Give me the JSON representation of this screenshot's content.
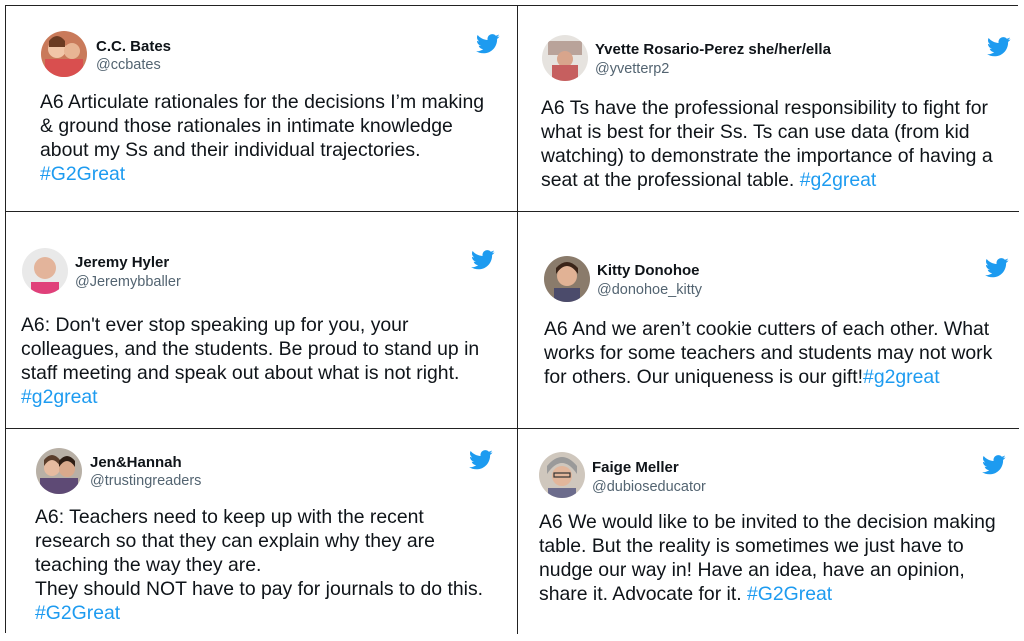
{
  "tweets": [
    {
      "name": "C.C. Bates",
      "handle": "@ccbates",
      "text": "A6 Articulate rationales for the decisions I’m making\n& ground those rationales in intimate knowledge\nabout my Ss and their individual trajectories.\n",
      "hashtag": "#G2Great"
    },
    {
      "name": "Yvette Rosario-Perez she/her/ella",
      "handle": "@yvetterp2",
      "text": "A6 Ts have the professional responsibility to fight for\nwhat is best for their Ss. Ts can use data (from kid\nwatching) to demonstrate the importance of having a\nseat at the professional table. ",
      "hashtag": "#g2great"
    },
    {
      "name": "Jeremy Hyler",
      "handle": "@Jeremybballer",
      "text": "A6: Don't ever stop speaking up for you, your\ncolleagues, and the students. Be proud to stand up in\nstaff meeting and speak out about what is not right.\n",
      "hashtag": "#g2great"
    },
    {
      "name": "Kitty Donohoe",
      "handle": "@donohoe_kitty",
      "text": "A6 And we aren’t cookie cutters of each other. What\nworks for some teachers and students may not work\nfor others. Our uniqueness is our gift!",
      "hashtag": "#g2great"
    },
    {
      "name": "Jen&Hannah",
      "handle": "@trustingreaders",
      "text": "A6: Teachers need to keep up with the recent\nresearch so that they can explain why they are\nteaching the way they are.\nThey should NOT have to pay for journals to do this.\n",
      "hashtag": "#G2Great"
    },
    {
      "name": "Faige Meller",
      "handle": "@dubioseducator",
      "text": "A6 We would like to be invited to the decision making\ntable. But the reality is sometimes we just have to\nnudge our way in! Have an idea, have an opinion,\nshare it. Advocate for it. ",
      "hashtag": "#G2Great"
    }
  ],
  "icons": {
    "bird": "twitter-bird-icon",
    "avatar": "avatar"
  },
  "colors": {
    "hashtag": "#1d9bf0",
    "twitter_blue": "#1d9bf0",
    "handle": "#536471",
    "border": "#222222"
  }
}
